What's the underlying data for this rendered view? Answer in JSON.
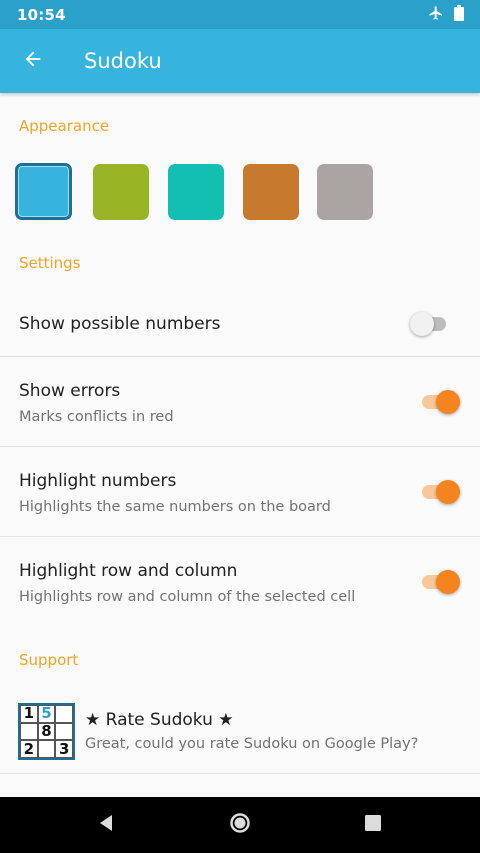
{
  "status_bar": {
    "time": "10:54",
    "icons": [
      "airplane-icon",
      "battery-icon"
    ]
  },
  "app_bar": {
    "title": "Sudoku",
    "back_icon": "arrow-left-icon"
  },
  "appearance": {
    "header": "Appearance",
    "swatches": [
      {
        "color": "#37b4de",
        "selected": true
      },
      {
        "color": "#97b525",
        "selected": false
      },
      {
        "color": "#13bfb1",
        "selected": false
      },
      {
        "color": "#c77a2e",
        "selected": false
      },
      {
        "color": "#aaa5a3",
        "selected": false
      }
    ]
  },
  "settings": {
    "header": "Settings",
    "items": [
      {
        "title": "Show possible numbers",
        "subtitle": "",
        "enabled": false
      },
      {
        "title": "Show errors",
        "subtitle": "Marks conflicts in red",
        "enabled": true
      },
      {
        "title": "Highlight numbers",
        "subtitle": "Highlights the same numbers on the board",
        "enabled": true
      },
      {
        "title": "Highlight row and column",
        "subtitle": "Highlights row and column of the selected cell",
        "enabled": true
      }
    ]
  },
  "support": {
    "header": "Support",
    "rate": {
      "title": "★ Rate Sudoku ★",
      "subtitle": "Great, could you rate Sudoku on Google Play?",
      "icon_cells": [
        "1",
        "5",
        "",
        "",
        "8",
        "",
        "2",
        "",
        "3"
      ]
    }
  },
  "colors": {
    "accent": "#f0a528",
    "primary": "#37b4de",
    "switch_on": "#f5841f"
  },
  "nav_bar": {
    "icons": [
      "back-triangle-icon",
      "home-circle-icon",
      "recents-square-icon"
    ]
  }
}
